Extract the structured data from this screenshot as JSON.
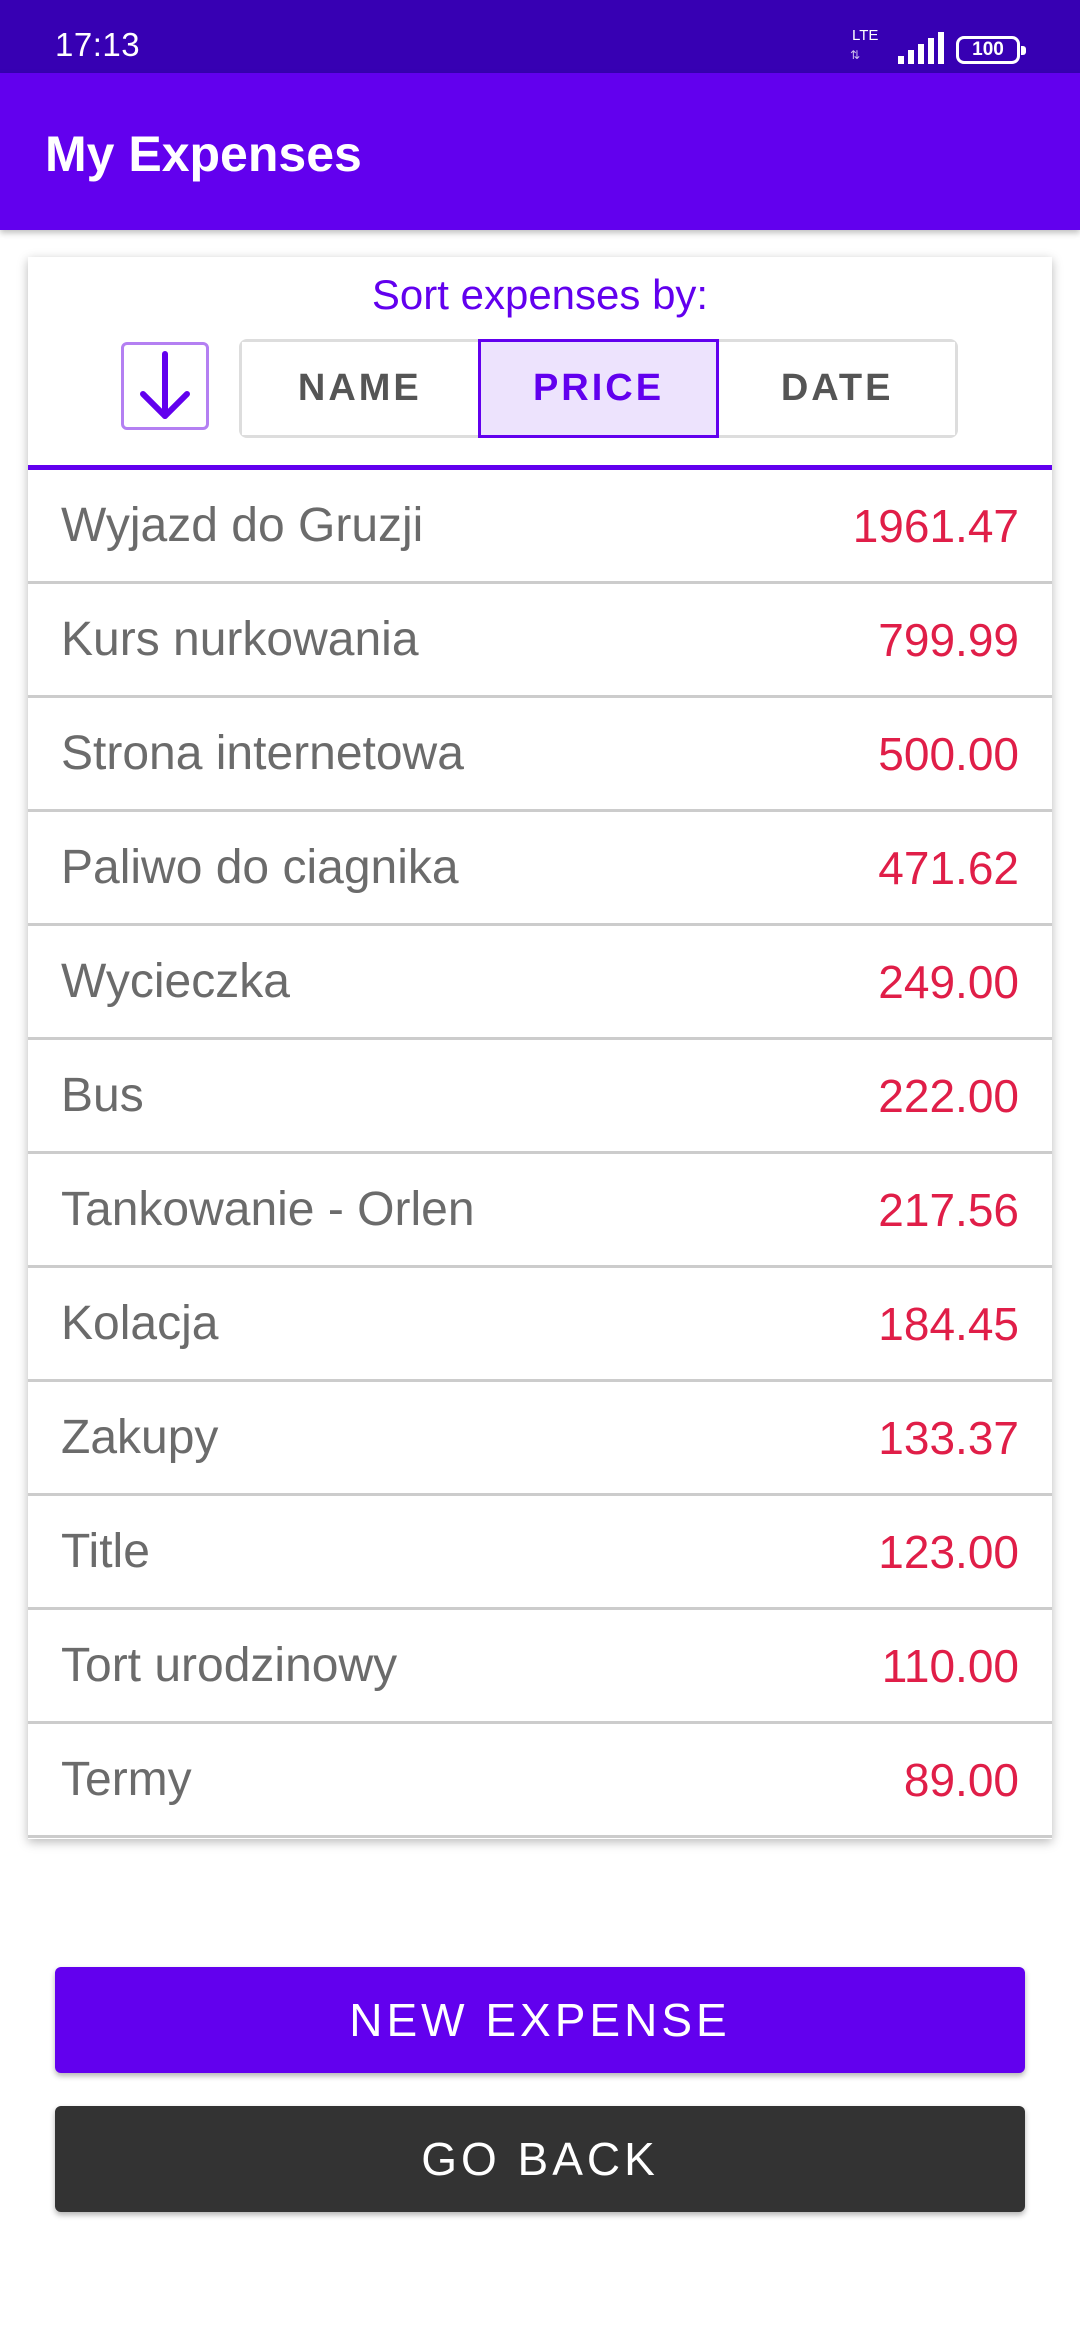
{
  "status_bar": {
    "time": "17:13",
    "network": "LTE",
    "battery": "100"
  },
  "app_bar": {
    "title": "My Expenses"
  },
  "sort": {
    "label": "Sort expenses by:",
    "direction_icon": "arrow-down-icon",
    "options": [
      {
        "label": "NAME",
        "selected": false
      },
      {
        "label": "PRICE",
        "selected": true
      },
      {
        "label": "DATE",
        "selected": false
      }
    ]
  },
  "expenses": [
    {
      "name": "Wyjazd do Gruzji",
      "price": "1961.47"
    },
    {
      "name": "Kurs nurkowania",
      "price": "799.99"
    },
    {
      "name": "Strona internetowa",
      "price": "500.00"
    },
    {
      "name": "Paliwo do ciagnika",
      "price": "471.62"
    },
    {
      "name": "Wycieczka",
      "price": "249.00"
    },
    {
      "name": "Bus",
      "price": "222.00"
    },
    {
      "name": "Tankowanie - Orlen",
      "price": "217.56"
    },
    {
      "name": "Kolacja",
      "price": "184.45"
    },
    {
      "name": "Zakupy",
      "price": "133.37"
    },
    {
      "name": "Title",
      "price": "123.00"
    },
    {
      "name": "Tort urodzinowy",
      "price": "110.00"
    },
    {
      "name": "Termy",
      "price": "89.00"
    }
  ],
  "actions": {
    "new_expense": "NEW EXPENSE",
    "go_back": "GO BACK"
  },
  "colors": {
    "primary": "#6200ee",
    "primary_dark": "#3700b3",
    "price": "#e01e48",
    "secondary_button": "#333333"
  }
}
